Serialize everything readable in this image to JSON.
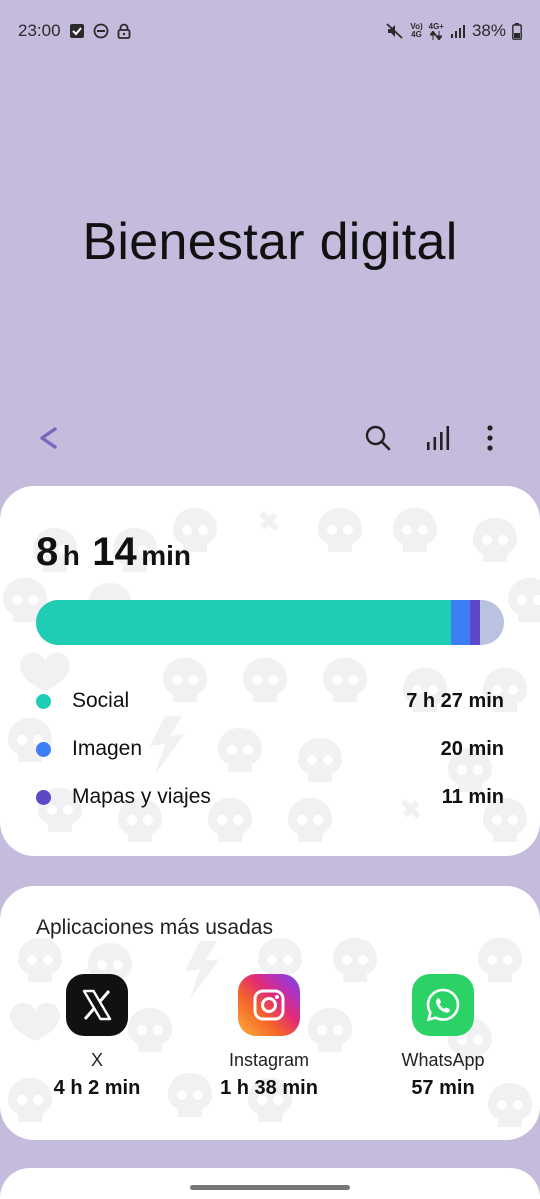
{
  "status_bar": {
    "time": "23:00",
    "network_top": "Vo)",
    "network_bottom": "4G",
    "network_type": "4G+",
    "battery": "38%",
    "icons": [
      "checkbox-notification-icon",
      "do-not-disturb-icon",
      "lock-icon",
      "mute-icon",
      "volte-icon",
      "data-arrows-icon",
      "signal-icon",
      "battery-icon"
    ]
  },
  "header": {
    "title": "Bienestar digital"
  },
  "toolbar": {
    "icons": [
      "back-icon",
      "search-icon",
      "stats-icon",
      "more-icon"
    ]
  },
  "summary": {
    "hours": "8",
    "hours_unit": "h",
    "minutes": "14",
    "minutes_unit": "min",
    "categories": [
      {
        "label": "Social",
        "value": "7 h 27 min",
        "minutes": 447,
        "color": "#1ecdb4"
      },
      {
        "label": "Imagen",
        "value": "20 min",
        "minutes": 20,
        "color": "#3d7ef5"
      },
      {
        "label": "Mapas y viajes",
        "value": "11 min",
        "minutes": 11,
        "color": "#5c48c9"
      }
    ],
    "remainder_color": "#b9c3e0"
  },
  "top_apps": {
    "title": "Aplicaciones más usadas",
    "apps": [
      {
        "name": "X",
        "time": "4 h 2 min",
        "icon": "x-app-icon"
      },
      {
        "name": "Instagram",
        "time": "1 h 38 min",
        "icon": "instagram-app-icon"
      },
      {
        "name": "WhatsApp",
        "time": "57 min",
        "icon": "whatsapp-app-icon"
      }
    ]
  }
}
